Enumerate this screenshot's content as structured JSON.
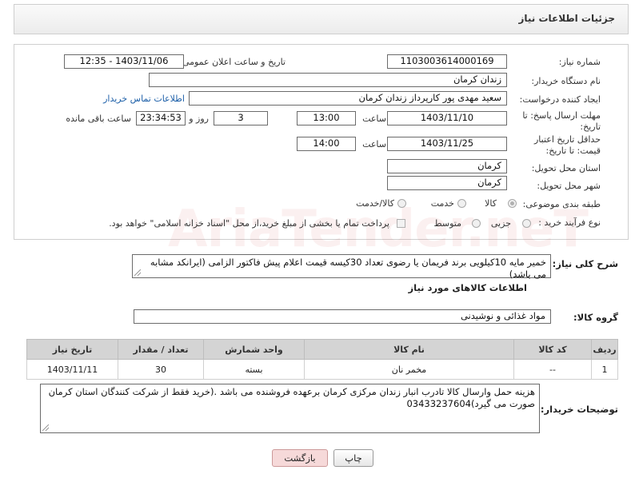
{
  "header": {
    "title": "جزئیات اطلاعات نیاز"
  },
  "form": {
    "need_number_label": "شماره نیاز:",
    "need_number": "1103003614000169",
    "announce_label": "تاریخ و ساعت اعلان عمومی:",
    "announce_value": "1403/11/06 - 12:35",
    "buyer_org_label": "نام دستگاه خریدار:",
    "buyer_org": "زندان کرمان",
    "requester_label": "ایجاد کننده درخواست:",
    "requester": "سعید مهدی پور کارپرداز زندان کرمان",
    "contact_link": "اطلاعات تماس خریدار",
    "reply_deadline_label": "مهلت ارسال پاسخ: تا تاریخ:",
    "reply_date": "1403/11/10",
    "time_label": "ساعت",
    "reply_time": "13:00",
    "days_value": "3",
    "days_label": "روز و",
    "remaining_time": "23:34:53",
    "remaining_label": "ساعت باقی مانده",
    "validity_label": "حداقل تاریخ اعتبار قیمت: تا تاریخ:",
    "validity_date": "1403/11/25",
    "validity_time": "14:00",
    "province_label": "استان محل تحویل:",
    "province": "کرمان",
    "city_label": "شهر محل تحویل:",
    "city": "کرمان",
    "category_label": "طبقه بندی موضوعی:",
    "category_options": [
      "کالا",
      "خدمت",
      "کالا/خدمت"
    ],
    "category_selected": "کالا",
    "process_label": "نوع فرآیند خرید :",
    "process_options": [
      "جزیی",
      "متوسط"
    ],
    "payment_note": "پرداخت تمام یا بخشی از مبلغ خرید،از محل \"اسناد خزانه اسلامی\" خواهد بود."
  },
  "description": {
    "label": "شرح کلی نیاز:",
    "text": "خمیر مایه 10کیلویی برند فریمان یا رضوی تعداد 30کیسه قیمت اعلام پیش فاکتور الزامی (ایرانکد مشابه می باشد)"
  },
  "goods_section": {
    "title": "اطلاعات کالاهای مورد نیاز",
    "group_label": "گروه کالا:",
    "group_value": "مواد غذائی و نوشیدنی"
  },
  "table": {
    "headers": [
      "ردیف",
      "کد کالا",
      "نام کالا",
      "واحد شمارش",
      "تعداد / مقدار",
      "تاریخ نیاز"
    ],
    "rows": [
      [
        "1",
        "--",
        "مخمر نان",
        "بسته",
        "30",
        "1403/11/11"
      ]
    ]
  },
  "buyer_notes": {
    "label": "توضیحات خریدار:",
    "text": "هزینه حمل وارسال کالا تادرب انبار زندان مرکزی کرمان برعهده فروشنده می باشد .(خرید فقط از شرکت کنندگان استان کرمان صورت می گیرد)03433237604"
  },
  "buttons": {
    "print": "چاپ",
    "back": "بازگشت"
  },
  "watermark": "AriaTender.neT",
  "colors": {
    "link": "#1c5fa8",
    "back_button_bg": "#f6d9d9",
    "table_header_bg": "#d4d4d4"
  }
}
